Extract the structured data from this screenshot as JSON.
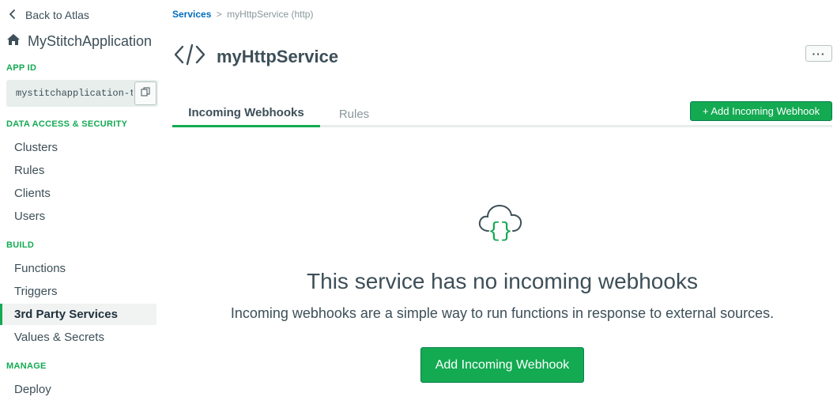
{
  "sidebar": {
    "back_label": "Back to Atlas",
    "app_name": "MyStitchApplication",
    "app_id_title": "APP ID",
    "app_id_value": "mystitchapplication-t",
    "sections": {
      "data_access": "DATA ACCESS & SECURITY",
      "build": "BUILD",
      "manage": "MANAGE"
    },
    "items": {
      "clusters": "Clusters",
      "rules": "Rules",
      "clients": "Clients",
      "users": "Users",
      "functions": "Functions",
      "triggers": "Triggers",
      "third_party": "3rd Party Services",
      "values": "Values & Secrets",
      "deploy": "Deploy"
    }
  },
  "breadcrumb": {
    "services": "Services",
    "separator": ">",
    "current": "myHttpService (http)"
  },
  "service": {
    "title": "myHttpService",
    "more_label": "···"
  },
  "tabs": {
    "incoming": "Incoming Webhooks",
    "rules": "Rules"
  },
  "actions": {
    "add_top": "+ Add Incoming Webhook",
    "add_main": "Add Incoming Webhook"
  },
  "empty_state": {
    "title": "This service has no incoming webhooks",
    "description": "Incoming webhooks are a simple way to run functions in response to external sources."
  },
  "colors": {
    "accent_green": "#13aa52",
    "link_blue": "#006cbc",
    "text": "#3d4f58"
  },
  "icons": [
    "chevron-left-icon",
    "home-icon",
    "copy-icon",
    "code-icon",
    "cloud-braces-icon"
  ]
}
